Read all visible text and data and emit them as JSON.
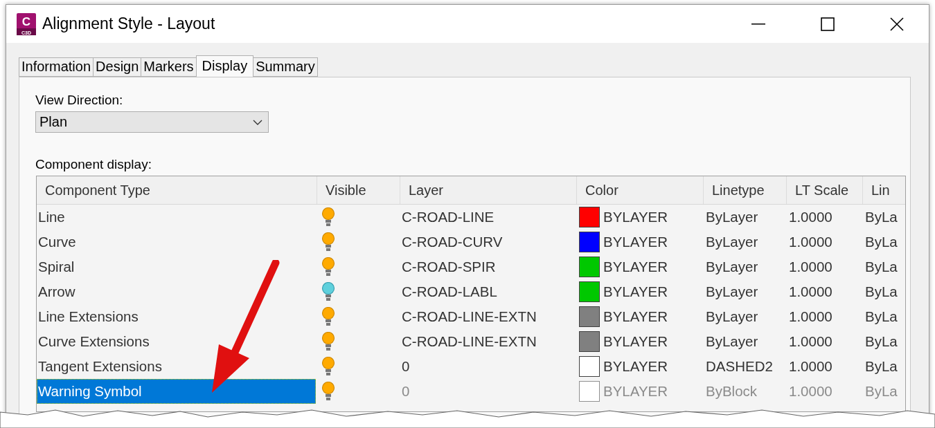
{
  "window": {
    "title": "Alignment Style - Layout",
    "app_icon": {
      "letter": "C",
      "sub": "C3D"
    }
  },
  "tabs": [
    {
      "label": "Information",
      "selected": false
    },
    {
      "label": "Design",
      "selected": false
    },
    {
      "label": "Markers",
      "selected": false
    },
    {
      "label": "Display",
      "selected": true
    },
    {
      "label": "Summary",
      "selected": false
    }
  ],
  "view_direction": {
    "label": "View Direction:",
    "value": "Plan"
  },
  "component_display": {
    "label": "Component display:",
    "columns": [
      "Component Type",
      "Visible",
      "Layer",
      "Color",
      "Linetype",
      "LT Scale",
      "Lin"
    ],
    "rows": [
      {
        "type": "Line",
        "visible": true,
        "layer": "C-ROAD-LINE",
        "color": "#ff0000",
        "color_text": "BYLAYER",
        "linetype": "ByLayer",
        "lt_scale": "1.0000",
        "column_7": "ByLa",
        "selected": false,
        "disabled": false
      },
      {
        "type": "Curve",
        "visible": true,
        "layer": "C-ROAD-CURV",
        "color": "#0000ff",
        "color_text": "BYLAYER",
        "linetype": "ByLayer",
        "lt_scale": "1.0000",
        "column_7": "ByLa",
        "selected": false,
        "disabled": false
      },
      {
        "type": "Spiral",
        "visible": true,
        "layer": "C-ROAD-SPIR",
        "color": "#00c800",
        "color_text": "BYLAYER",
        "linetype": "ByLayer",
        "lt_scale": "1.0000",
        "column_7": "ByLa",
        "selected": false,
        "disabled": false
      },
      {
        "type": "Arrow",
        "visible": false,
        "layer": "C-ROAD-LABL",
        "color": "#00c800",
        "color_text": "BYLAYER",
        "linetype": "ByLayer",
        "lt_scale": "1.0000",
        "column_7": "ByLa",
        "selected": false,
        "disabled": false
      },
      {
        "type": "Line Extensions",
        "visible": true,
        "layer": "C-ROAD-LINE-EXTN",
        "color": "#808080",
        "color_text": "BYLAYER",
        "linetype": "ByLayer",
        "lt_scale": "1.0000",
        "column_7": "ByLa",
        "selected": false,
        "disabled": false
      },
      {
        "type": "Curve Extensions",
        "visible": true,
        "layer": "C-ROAD-LINE-EXTN",
        "color": "#808080",
        "color_text": "BYLAYER",
        "linetype": "ByLayer",
        "lt_scale": "1.0000",
        "column_7": "ByLa",
        "selected": false,
        "disabled": false
      },
      {
        "type": "Tangent Extensions",
        "visible": true,
        "layer": "0",
        "color": "#ffffff",
        "color_text": "BYLAYER",
        "linetype": "DASHED2",
        "lt_scale": "1.0000",
        "column_7": "ByLa",
        "selected": false,
        "disabled": false
      },
      {
        "type": "Warning Symbol",
        "visible": true,
        "layer": "0",
        "color": "#ffffff",
        "color_text": "BYLAYER",
        "linetype": "ByBlock",
        "lt_scale": "1.0000",
        "column_7": "ByLa",
        "selected": true,
        "disabled": true
      }
    ]
  }
}
